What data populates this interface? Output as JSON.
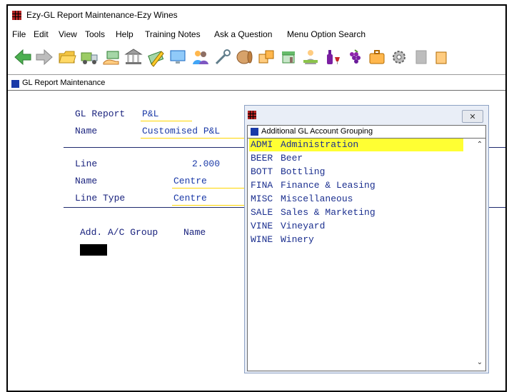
{
  "window": {
    "title": "Ezy-GL Report Maintenance-Ezy Wines"
  },
  "menu": [
    "File",
    "Edit",
    "View",
    "Tools",
    "Help",
    "Training Notes",
    "Ask a Question",
    "Menu Option Search"
  ],
  "toolbar": {
    "icons": [
      "back-arrow-icon",
      "forward-arrow-icon",
      "folder-icon",
      "truck-icon",
      "hand-money-icon",
      "bank-icon",
      "pencil-cash-icon",
      "monitor-icon",
      "users-icon",
      "wrench-icon",
      "barrel-icon",
      "boxes-icon",
      "shop-icon",
      "worker-icon",
      "wine-bottle-icon",
      "grapes-icon",
      "briefcase-icon",
      "gear-icon",
      "gray-box-icon",
      "package-icon"
    ]
  },
  "form": {
    "window_title": "GL Report Maintenance",
    "gl_report_label": "GL Report",
    "gl_report_value": "P&L",
    "name_label": "Name",
    "name_value": "Customised P&L",
    "line_label": "Line",
    "line_value": "2.000",
    "line_name_label": "Name",
    "line_name_value": "Centre",
    "line_type_label": "Line Type",
    "line_type_value": "Centre",
    "group_header_1": "Add. A/C Group",
    "group_header_2": "Name"
  },
  "popup": {
    "title": "Additional GL Account Grouping",
    "close_label": "✕",
    "items": [
      {
        "code": "ADMI",
        "name": "Administration",
        "selected": true
      },
      {
        "code": "BEER",
        "name": "Beer",
        "selected": false
      },
      {
        "code": "BOTT",
        "name": "Bottling",
        "selected": false
      },
      {
        "code": "FINA",
        "name": "Finance & Leasing",
        "selected": false
      },
      {
        "code": "MISC",
        "name": "Miscellaneous",
        "selected": false
      },
      {
        "code": "SALE",
        "name": "Sales & Marketing",
        "selected": false
      },
      {
        "code": "VINE",
        "name": "Vineyard",
        "selected": false
      },
      {
        "code": "WINE",
        "name": "Winery",
        "selected": false
      }
    ]
  },
  "colors": {
    "accent_blue": "#1b3aa8",
    "selection": "#ffff33",
    "app_icon_red": "#b22222"
  }
}
